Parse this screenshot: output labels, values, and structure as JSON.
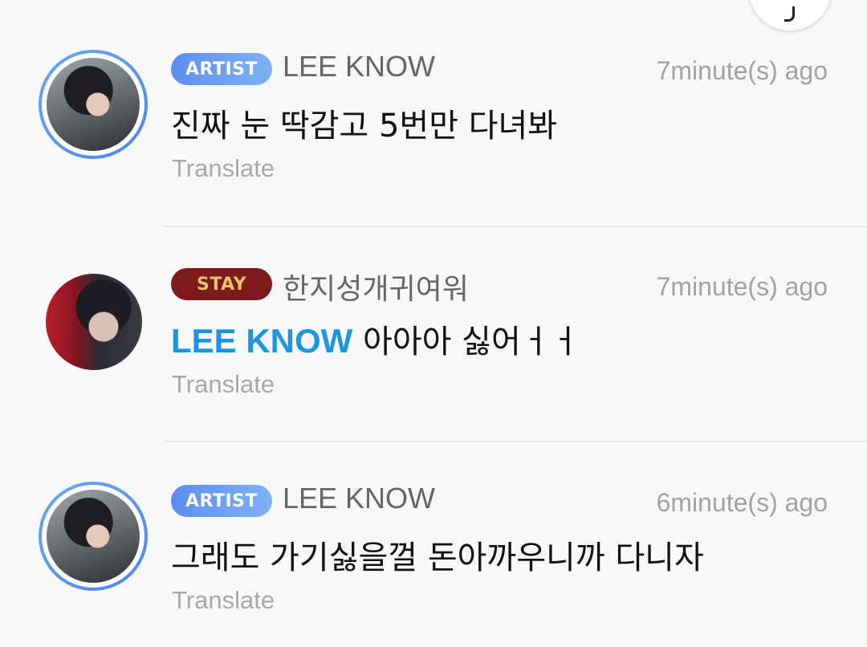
{
  "comments": [
    {
      "badge": "ARTIST",
      "author": "LEE KNOW",
      "time": "7minute(s) ago",
      "mention": "",
      "text": "진짜 눈 딱감고 5번만 다녀봐",
      "translate_label": "Translate"
    },
    {
      "badge": "STAY",
      "author": "한지성개귀여워",
      "time": "7minute(s) ago",
      "mention": "LEE KNOW",
      "text": " 아아아 싫어ㅓㅓ",
      "translate_label": "Translate"
    },
    {
      "badge": "ARTIST",
      "author": "LEE KNOW",
      "time": "6minute(s) ago",
      "mention": "",
      "text": "그래도 가기싫을껄  돈아까우니까 다니자",
      "translate_label": "Translate"
    }
  ],
  "colors": {
    "artist_badge": "#5b8ef0",
    "stay_badge": "#7c1a1c",
    "mention": "#1e95e0"
  }
}
